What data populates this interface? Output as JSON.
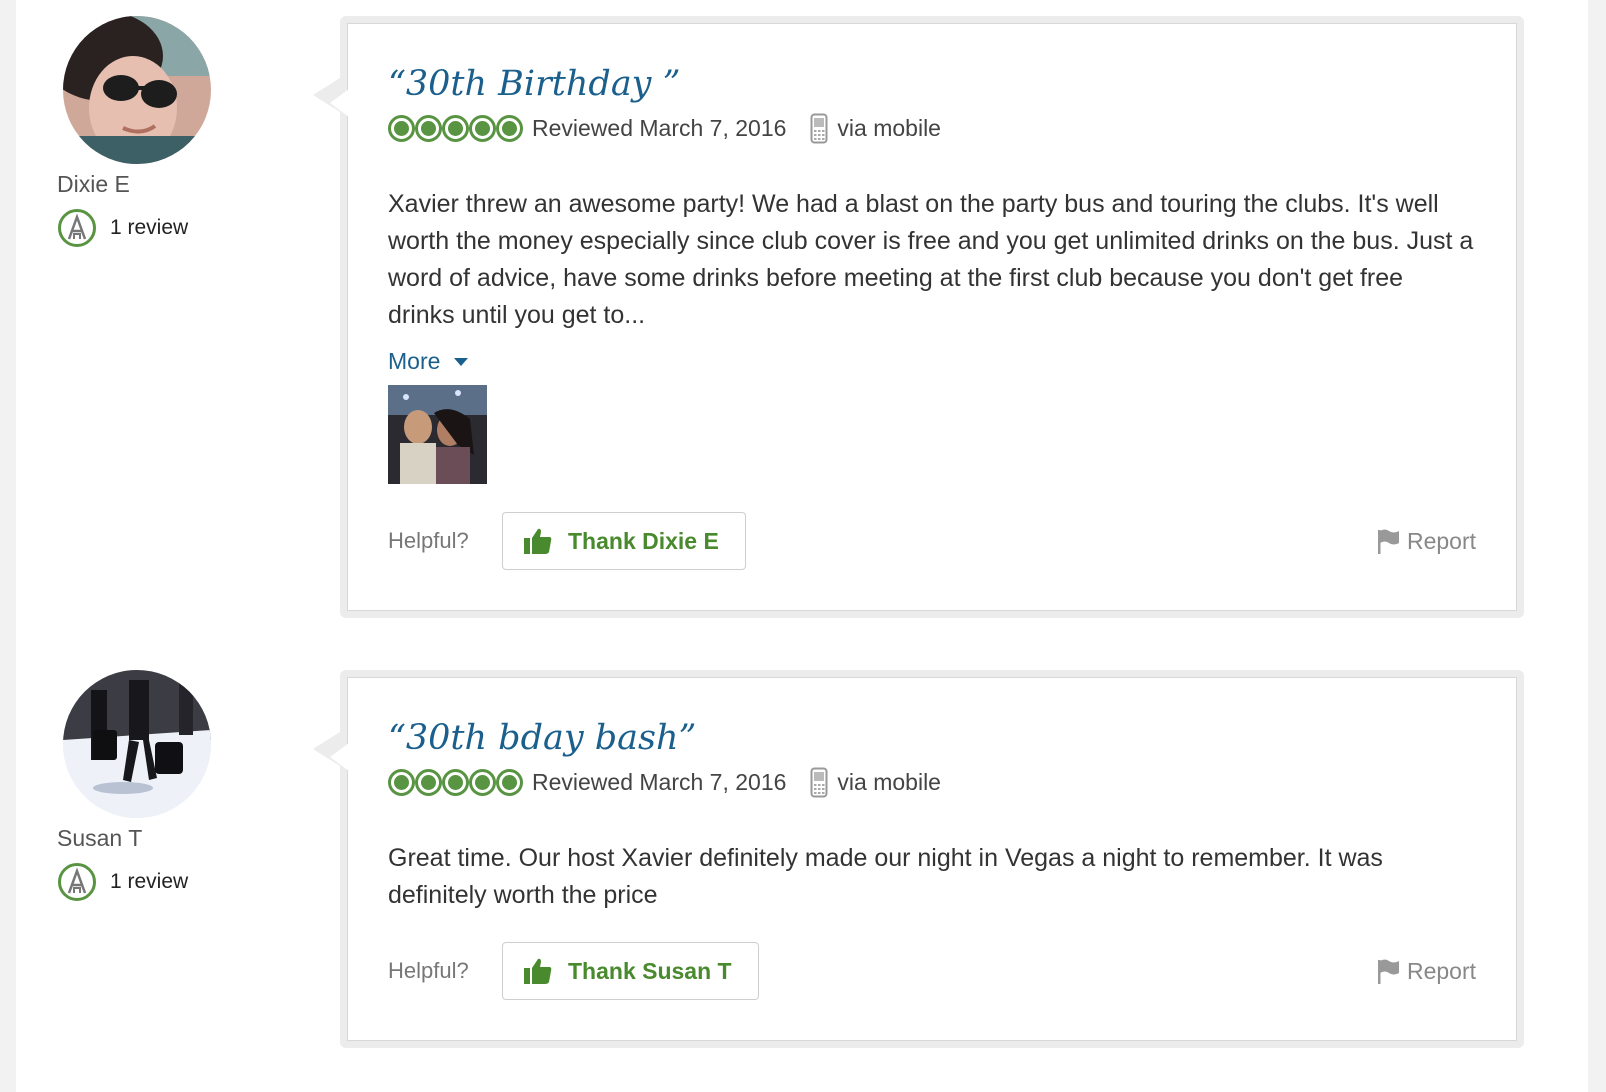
{
  "reviews": [
    {
      "member": {
        "name": "Dixie E",
        "review_count": "1 review",
        "avatar_icon": "profile-photo"
      },
      "title": "“30th Birthday ”",
      "rating_bubbles": 5,
      "reviewed": "Reviewed March 7, 2016",
      "via": "via mobile",
      "body": "Xavier threw an awesome party! We had a blast on the party bus and touring the clubs. It's well worth the money especially since club cover is free and you get unlimited drinks on the bus. Just a word of advice, have some drinks before meeting at the first club because you don't get free drinks until you get to...",
      "more_label": "More",
      "helpful_label": "Helpful?",
      "thank_label": "Thank Dixie E",
      "report_label": "Report"
    },
    {
      "member": {
        "name": "Susan T",
        "review_count": "1 review",
        "avatar_icon": "travelers-photo"
      },
      "title": "“30th bday bash”",
      "rating_bubbles": 5,
      "reviewed": "Reviewed March 7, 2016",
      "via": "via mobile",
      "body": "Great time. Our host Xavier definitely made our night in Vegas a night to remember. It was definitely worth the price",
      "helpful_label": "Helpful?",
      "thank_label": "Thank Susan T",
      "report_label": "Report"
    }
  ],
  "colors": {
    "link_blue": "#1b5f8c",
    "rating_green": "#589442",
    "thank_green": "#4a8a2e"
  }
}
